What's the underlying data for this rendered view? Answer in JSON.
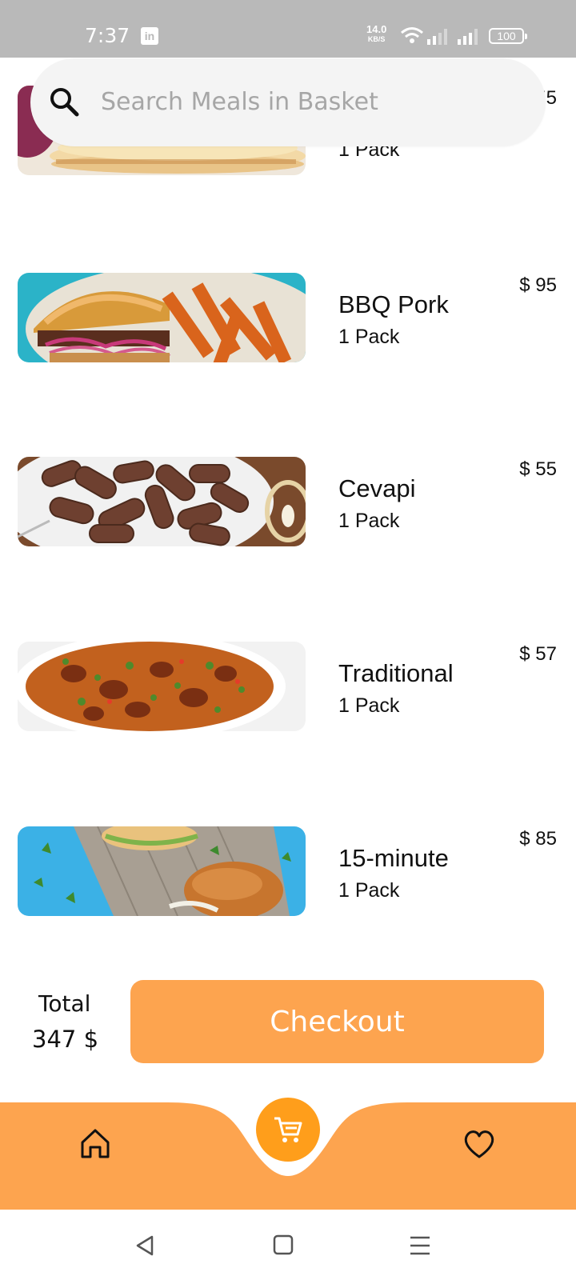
{
  "status_bar": {
    "time": "7:37",
    "app_badge": "in",
    "net_speed": "14.0",
    "net_unit": "KB/S",
    "battery": "100"
  },
  "search": {
    "placeholder": "Search Meals in Basket"
  },
  "items": [
    {
      "name": "",
      "pack": "1 Pack",
      "price": "$ 55",
      "image": "pancakes-photo"
    },
    {
      "name": "BBQ Pork",
      "pack": "1 Pack",
      "price": "$ 95",
      "image": "bbq-pork-photo"
    },
    {
      "name": "Cevapi",
      "pack": "1 Pack",
      "price": "$ 55",
      "image": "cevapi-photo"
    },
    {
      "name": "Traditional",
      "pack": "1 Pack",
      "price": "$ 57",
      "image": "stew-photo"
    },
    {
      "name": "15-minute",
      "pack": "1 Pack",
      "price": "$ 85",
      "image": "burger-board-photo"
    }
  ],
  "checkout": {
    "total_label": "Total",
    "total_value": "347 $",
    "button_label": "Checkout"
  },
  "bottom_nav": {
    "home_icon": "home-icon",
    "cart_icon": "cart-icon",
    "favorites_icon": "heart-icon"
  },
  "colors": {
    "accent": "#fda44f",
    "nav_bar": "#fda44f",
    "cart_button": "#ff9e1b",
    "status_bar": "#b9b9b9",
    "search_bg": "#f4f4f4"
  }
}
